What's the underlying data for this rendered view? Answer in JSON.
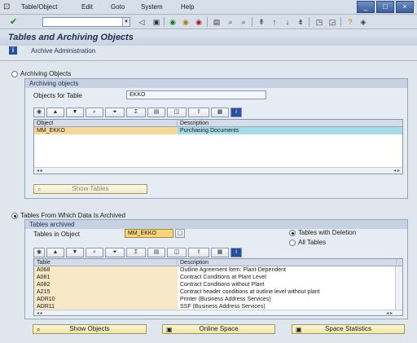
{
  "menu": {
    "items": [
      "Table/Object",
      "Edit",
      "Goto",
      "System",
      "Help"
    ]
  },
  "window": {
    "controls": [
      "_",
      "□",
      "×"
    ]
  },
  "toolbar": {
    "command_value": ""
  },
  "header": {
    "title": "Tables and Archiving Objects"
  },
  "app_toolbar": {
    "archive_admin_label": "Archive Administration"
  },
  "archiving_objects": {
    "radio_label": "Archiving Objects",
    "group_title": "Archiving objects",
    "objects_for_table_label": "Objects for Table",
    "objects_for_table_value": "EKKO",
    "columns": [
      "Object",
      "Description"
    ],
    "rows": [
      {
        "object": "MM_EKKO",
        "description": "Purchasing Documents"
      }
    ],
    "show_tables_button": "Show Tables"
  },
  "tables_archived": {
    "radio_label": "Tables From Which Data Is Archived",
    "group_title": "Tables archived",
    "tables_in_object_label": "Tables in Object",
    "tables_in_object_value": "MM_EKKO",
    "option_with_deletion": "Tables with Deletion",
    "option_all": "All Tables",
    "columns": [
      "Table",
      "Description"
    ],
    "rows": [
      {
        "table": "A068",
        "description": "Outline Agreement Item: Plant-Dependent"
      },
      {
        "table": "A081",
        "description": "Contract Conditions at Plant Level"
      },
      {
        "table": "A082",
        "description": "Contract Conditions without Plant"
      },
      {
        "table": "A215",
        "description": "Contract header conditions at outline level without plant"
      },
      {
        "table": "ADR10",
        "description": "Printer (Business Address Services)"
      },
      {
        "table": "ADR11",
        "description": "SSF (Business Address Services)"
      }
    ]
  },
  "bottom_buttons": {
    "show_objects": "Show Objects",
    "online_space": "Online Space",
    "space_statistics": "Space Statistics"
  }
}
